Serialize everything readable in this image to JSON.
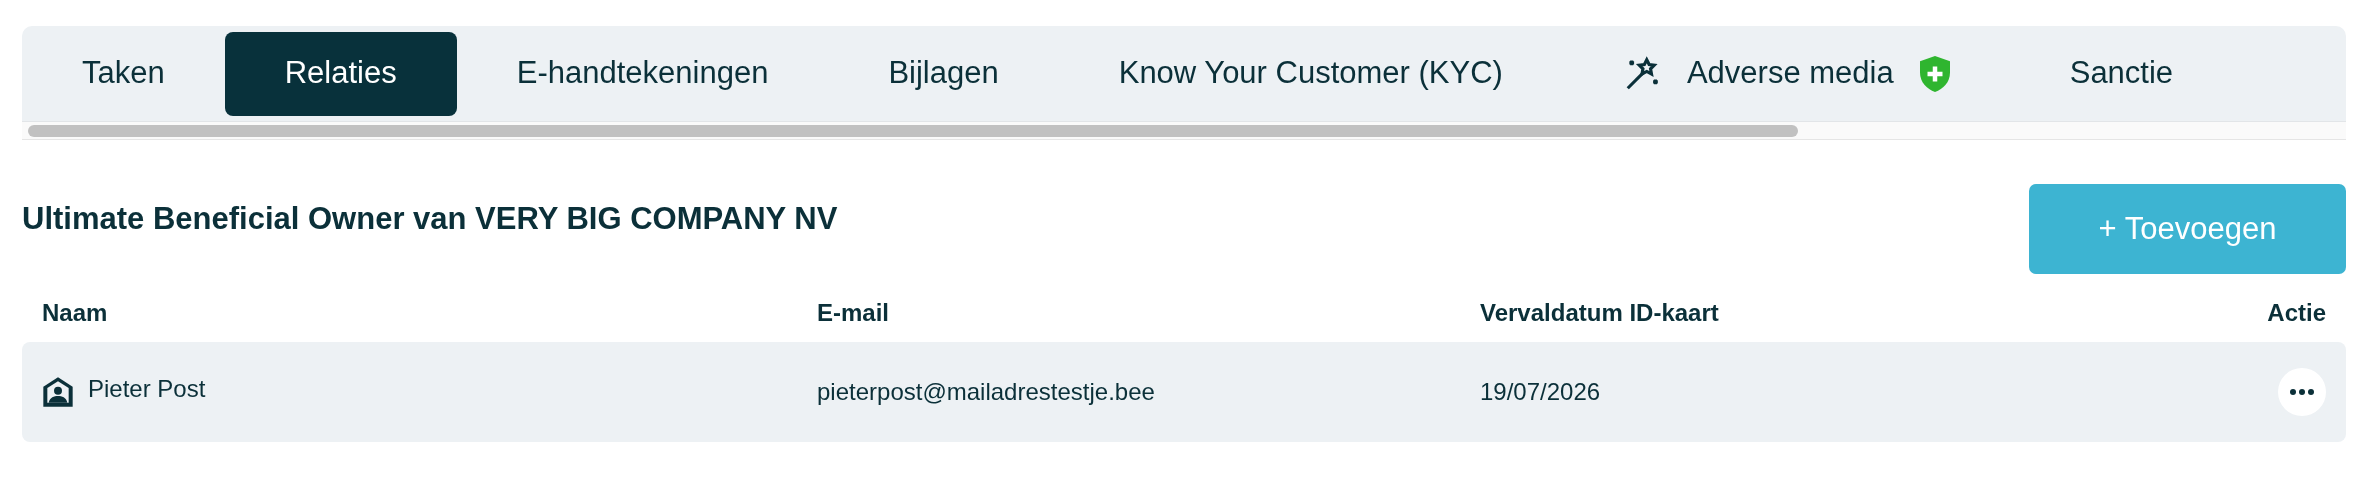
{
  "tabs": [
    {
      "label": "Taken",
      "selected": false,
      "kind": "plain"
    },
    {
      "label": "Relaties",
      "selected": true,
      "kind": "plain"
    },
    {
      "label": "E-handtekeningen",
      "selected": false,
      "kind": "plain"
    },
    {
      "label": "Bijlagen",
      "selected": false,
      "kind": "plain"
    },
    {
      "label": "Know Your Customer (KYC)",
      "selected": false,
      "kind": "plain"
    },
    {
      "label": "Adverse media",
      "selected": false,
      "kind": "adverse"
    },
    {
      "label": "Sanctie",
      "selected": false,
      "kind": "plain"
    }
  ],
  "section": {
    "title": "Ultimate Beneficial Owner van VERY BIG COMPANY NV",
    "add_button": "+ Toevoegen"
  },
  "table": {
    "columns": [
      "Naam",
      "E-mail",
      "Vervaldatum ID-kaart",
      "Actie"
    ],
    "rows": [
      {
        "name": "Pieter Post",
        "email": "pieterpost@mailadrestestje.bee",
        "id_expiry": "19/07/2026"
      }
    ]
  }
}
